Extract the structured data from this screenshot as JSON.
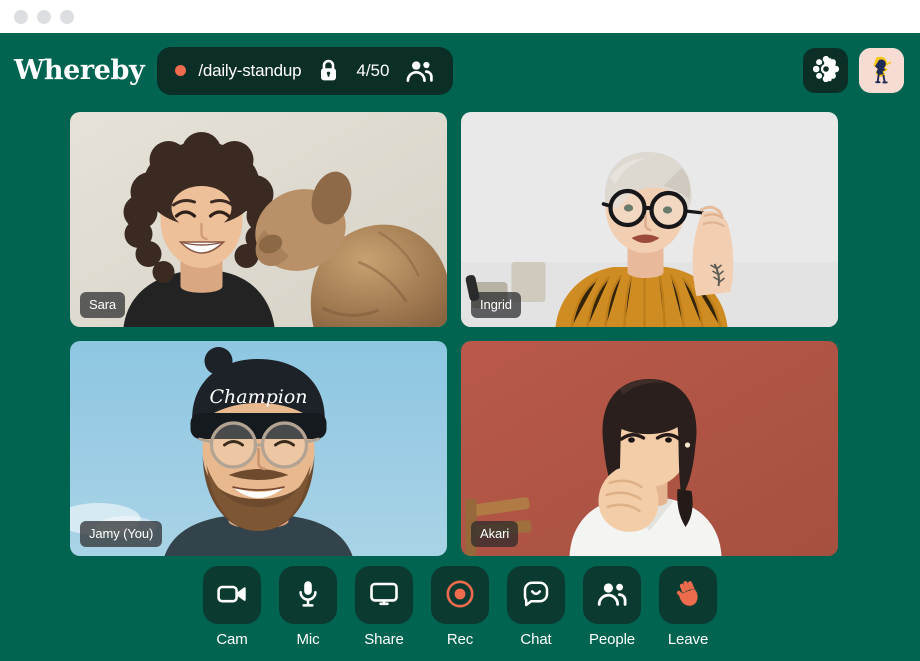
{
  "window": {
    "chrome_dots": [
      "dot-close",
      "dot-minimize",
      "dot-maximize"
    ],
    "chrome_dot_color": "#dcdee1",
    "titlebar_bg": "#ffffff"
  },
  "theme": {
    "app_bg": "#006450",
    "chip_bg": "#0b2e26",
    "button_bg": "#0b3a30",
    "accent_orange": "#ee6c4d",
    "text_on_dark": "#ffffff",
    "badge_bg": "rgba(40,42,43,0.72)",
    "avatar_bg": "#f7dcd4"
  },
  "header": {
    "brand": "Whereby",
    "live_dot_color": "#ee6c4d",
    "room_name": "/daily-standup",
    "lock_icon": "lock-icon",
    "participant_count": "4/50",
    "people_icon": "people-icon",
    "settings_icon": "gear-icon",
    "avatar_icon": "user-avatar"
  },
  "video_grid": {
    "tiles": [
      {
        "name": "Sara",
        "position": "top-left",
        "bg_color": "#e0ddd4",
        "description": "smiling woman with curly dark hair and a small dog",
        "self_view": false
      },
      {
        "name": "Ingrid",
        "position": "top-right",
        "bg_color": "#e9e9ea",
        "description": "woman with short light blonde hair, black glasses, mustard sweater",
        "self_view": false
      },
      {
        "name": "Jamy (You)",
        "position": "bottom-left",
        "bg_color": "#8fc6e0",
        "description": "bearded man with beanie and glasses against a blue sky",
        "self_view": true
      },
      {
        "name": "Akari",
        "position": "bottom-right",
        "bg_color": "#b45c4e",
        "description": "woman with dark bob hair in a white top on a terracotta wall",
        "self_view": false
      }
    ]
  },
  "toolbar": {
    "items": [
      {
        "label": "Cam",
        "icon": "video-camera-icon",
        "active": false,
        "accent": false
      },
      {
        "label": "Mic",
        "icon": "microphone-icon",
        "active": false,
        "accent": false
      },
      {
        "label": "Share",
        "icon": "screen-share-icon",
        "active": false,
        "accent": false
      },
      {
        "label": "Rec",
        "icon": "record-icon",
        "active": false,
        "accent": true
      },
      {
        "label": "Chat",
        "icon": "chat-bubble-icon",
        "active": false,
        "accent": false
      },
      {
        "label": "People",
        "icon": "people-icon",
        "active": false,
        "accent": false
      },
      {
        "label": "Leave",
        "icon": "waving-hand-icon",
        "active": false,
        "accent": true
      }
    ]
  }
}
